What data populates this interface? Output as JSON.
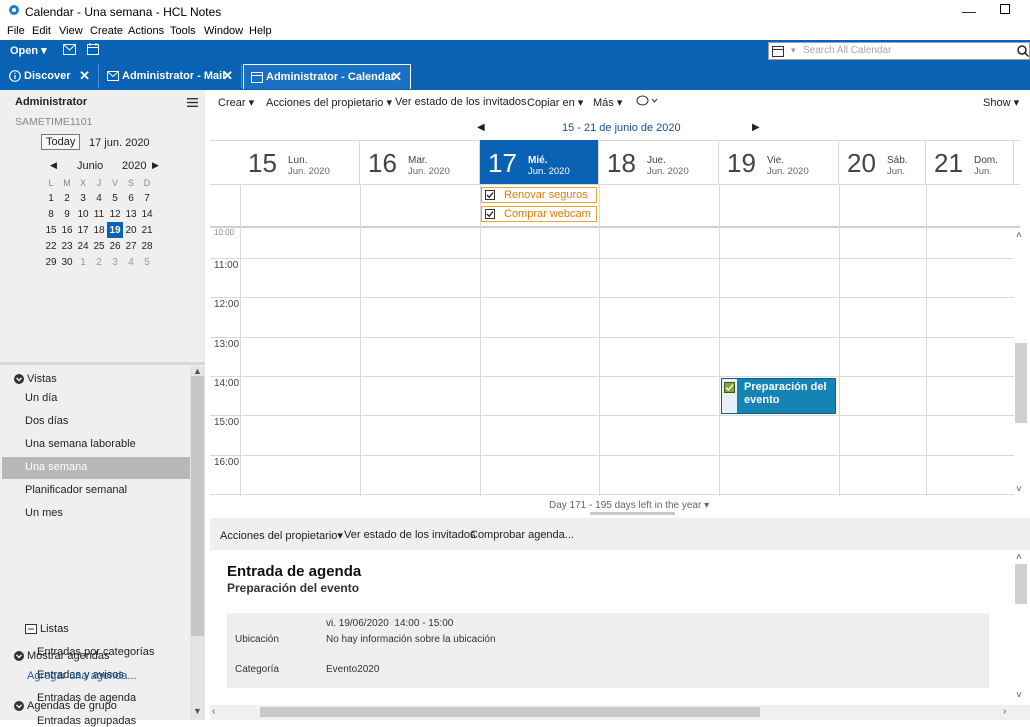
{
  "window": {
    "title": "Calendar - Una semana - HCL Notes"
  },
  "menubar": [
    "File",
    "Edit",
    "View",
    "Create",
    "Actions",
    "Tools",
    "Window",
    "Help"
  ],
  "toolbar": {
    "open_label": "Open",
    "search_placeholder": "Search All Calendar"
  },
  "tabs": [
    {
      "label": "Discover",
      "icon": "info-icon"
    },
    {
      "label": "Administrator - Mail",
      "icon": "mail-icon"
    },
    {
      "label": "Administrator - Calendar",
      "icon": "calendar-icon"
    }
  ],
  "sidebar": {
    "user": "Administrator",
    "server": "SAMETIME1101",
    "today_btn": "Today",
    "today_date": "17 jun. 2020",
    "month": "Junio",
    "year": "2020",
    "weekdays": [
      "L",
      "M",
      "X",
      "J",
      "V",
      "S",
      "D"
    ],
    "weeks": [
      [
        "1",
        "2",
        "3",
        "4",
        "5",
        "6",
        "7"
      ],
      [
        "8",
        "9",
        "10",
        "11",
        "12",
        "13",
        "14"
      ],
      [
        "15",
        "16",
        "17",
        "18",
        "19",
        "20",
        "21"
      ],
      [
        "22",
        "23",
        "24",
        "25",
        "26",
        "27",
        "28"
      ],
      [
        "29",
        "30",
        "1",
        "2",
        "3",
        "4",
        "5"
      ]
    ],
    "selected_day": "19",
    "views_header": "Vistas",
    "views": [
      "Un día",
      "Dos días",
      "Una semana laborable",
      "Una semana",
      "Planificador semanal",
      "Un mes"
    ],
    "selected_view": "Una semana",
    "lists_header": "Listas",
    "lists": [
      "Entradas por categorías",
      "Entradas y avisos",
      "Entradas de agenda",
      "Entradas agrupadas"
    ],
    "show_calendars": "Mostrar agendas",
    "add_calendar": "Agregar una agenda...",
    "group_calendars": "Agendas de grupo"
  },
  "actions": {
    "crear": "Crear",
    "acciones": "Acciones del propietario",
    "ver_estado": "Ver estado de los invitados",
    "copiar": "Copiar en",
    "mas": "Más",
    "show": "Show"
  },
  "calendar": {
    "range": "15 - 21 de junio de 2020",
    "days": [
      {
        "num": "15",
        "name": "Lun.",
        "month": "Jun. 2020"
      },
      {
        "num": "16",
        "name": "Mar.",
        "month": "Jun. 2020"
      },
      {
        "num": "17",
        "name": "Mié.",
        "month": "Jun. 2020"
      },
      {
        "num": "18",
        "name": "Jue.",
        "month": "Jun. 2020"
      },
      {
        "num": "19",
        "name": "Vie.",
        "month": "Jun. 2020"
      },
      {
        "num": "20",
        "name": "Sáb.",
        "month": "Jun."
      },
      {
        "num": "21",
        "name": "Dom.",
        "month": "Jun."
      }
    ],
    "today_index": 2,
    "tasks": [
      "Renovar seguros",
      "Comprar webcam"
    ],
    "hours": [
      "11:00",
      "12:00",
      "13:00",
      "14:00",
      "15:00",
      "16:00"
    ],
    "event": {
      "title": "Preparación del evento"
    },
    "footer": "Day 171 - 195 days left in the year"
  },
  "detail_actions": {
    "acciones": "Acciones del propietario",
    "ver_estado": "Ver estado de los invitados",
    "comprobar": "Comprobar agenda..."
  },
  "detail": {
    "header": "Entrada de agenda",
    "subject": "Preparación del evento",
    "date": "vi. 19/06/2020",
    "time": "14:00 - 15:00",
    "location_label": "Ubicación",
    "location_value": "No hay información sobre la ubicación",
    "category_label": "Categoría",
    "category_value": "Evento2020"
  }
}
